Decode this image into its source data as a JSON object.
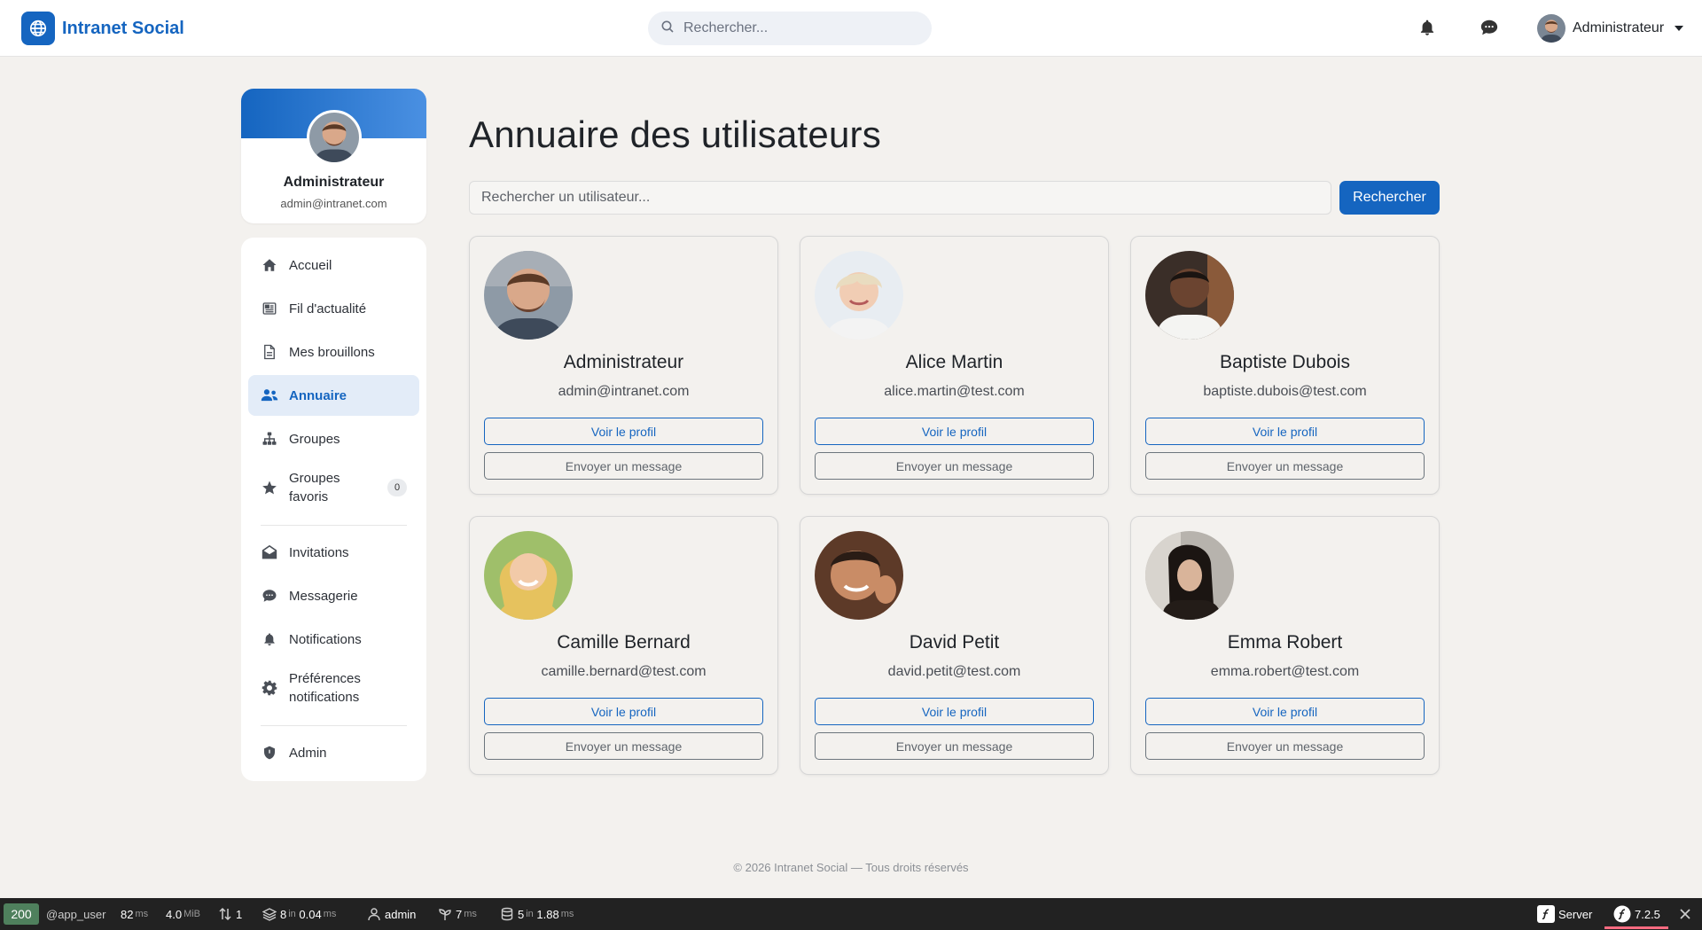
{
  "app": {
    "name": "Intranet Social"
  },
  "navbar": {
    "search_placeholder": "Rechercher...",
    "user_name": "Administrateur"
  },
  "profile": {
    "name": "Administrateur",
    "email": "admin@intranet.com"
  },
  "sidebar": {
    "items": [
      {
        "label": "Accueil",
        "icon": "home-icon"
      },
      {
        "label": "Fil d'actualité",
        "icon": "newspaper-icon"
      },
      {
        "label": "Mes brouillons",
        "icon": "file-icon"
      },
      {
        "label": "Annuaire",
        "icon": "users-icon",
        "active": true
      },
      {
        "label": "Groupes",
        "icon": "sitemap-icon"
      },
      {
        "label": "Groupes favoris",
        "icon": "star-icon",
        "badge": "0"
      },
      {
        "label": "Invitations",
        "icon": "envelope-icon"
      },
      {
        "label": "Messagerie",
        "icon": "chat-icon"
      },
      {
        "label": "Notifications",
        "icon": "bell-icon"
      },
      {
        "label": "Préférences notifications",
        "icon": "gear-icon"
      },
      {
        "label": "Admin",
        "icon": "shield-icon"
      }
    ]
  },
  "main": {
    "title": "Annuaire des utilisateurs",
    "search_placeholder": "Rechercher un utilisateur...",
    "search_button": "Rechercher",
    "profile_button": "Voir le profil",
    "message_button": "Envoyer un message",
    "users": [
      {
        "name": "Administrateur",
        "email": "admin@intranet.com"
      },
      {
        "name": "Alice Martin",
        "email": "alice.martin@test.com"
      },
      {
        "name": "Baptiste Dubois",
        "email": "baptiste.dubois@test.com"
      },
      {
        "name": "Camille Bernard",
        "email": "camille.bernard@test.com"
      },
      {
        "name": "David Petit",
        "email": "david.petit@test.com"
      },
      {
        "name": "Emma Robert",
        "email": "emma.robert@test.com"
      }
    ]
  },
  "footer": {
    "text": "© 2026 Intranet Social — Tous droits réservés"
  },
  "debugbar": {
    "status": "200",
    "route": "@app_user",
    "time": "82",
    "time_unit": "ms",
    "memory": "4.0",
    "memory_unit": "MiB",
    "requests": "1",
    "twig_count": "8",
    "twig_in": "in",
    "twig_time": "0.04",
    "twig_unit": "ms",
    "user": "admin",
    "http_time": "7",
    "http_unit": "ms",
    "db_count": "5",
    "db_in": "in",
    "db_time": "1.88",
    "db_unit": "ms",
    "server_label": "Server",
    "version": "7.2.5"
  },
  "colors": {
    "primary": "#1565c0",
    "background": "#f3f1ee",
    "active_bg": "#e3ecf8",
    "status_ok": "#4f805d"
  }
}
